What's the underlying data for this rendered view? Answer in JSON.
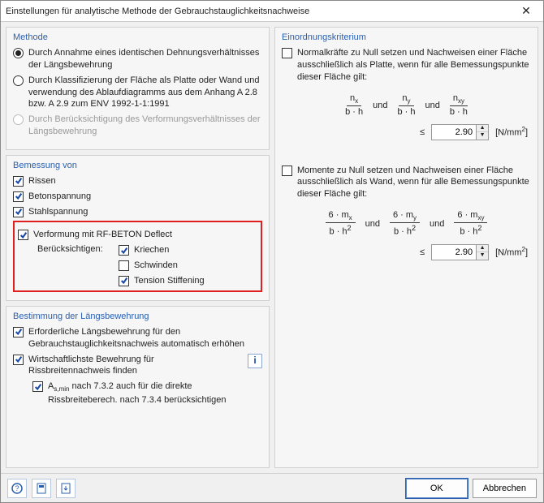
{
  "window": {
    "title": "Einstellungen für analytische Methode der Gebrauchstauglichkeitsnachweise"
  },
  "method": {
    "legend": "Methode",
    "opt1": "Durch Annahme eines identischen Dehnungsverhältnisses der Längsbewehrung",
    "opt2": "Durch Klassifizierung der Fläche als Platte oder Wand und verwendung des Ablaufdiagramms aus dem Anhang A 2.8 bzw. A 2.9 zum ENV 1992-1-1:1991",
    "opt3": "Durch Berücksichtigung des Verformungs­verhältnisses der Längsbewehrung"
  },
  "design": {
    "legend": "Bemessung von",
    "c1": "Rissen",
    "c2": "Betonspannung",
    "c3": "Stahlspannung",
    "c4": "Verformung mit RF-BETON Deflect",
    "sublabel": "Berücksichtigen:",
    "s1": "Kriechen",
    "s2": "Schwinden",
    "s3": "Tension Stiffening"
  },
  "longitudinal": {
    "legend": "Bestimmung der Längsbewehrung",
    "c1": "Erforderliche Längsbewehrung für den Gebrauchstauglichkeitsnachweis automatisch erhöhen",
    "c2": "Wirtschaftlichste Bewehrung für Rissbreitennachweis finden",
    "c3_pre": "A",
    "c3_sub": "s,min",
    "c3_post": " nach 7.3.2 auch für die direkte Rissbreiteberech. nach 7.3.4 berücksichtigen"
  },
  "classification": {
    "legend": "Einordnungskriterium",
    "c1": "Normalkräfte zu Null setzen und Nachweisen einer Fläche ausschließlich als Platte, wenn für alle Bemessungspunkte dieser Fläche gilt:",
    "c2": "Momente zu Null setzen und Nachweisen einer Fläche ausschließlich als Wand, wenn für alle Bemessungspunkte dieser Fläche gilt:",
    "and": "und",
    "leq": "≤",
    "val1": "2.90",
    "val2": "2.90",
    "unit_pre": "[N/mm",
    "unit_sup": "2",
    "unit_post": "]",
    "f1": {
      "n": "n",
      "idx_x": "x",
      "idx_y": "y",
      "idx_xy": "xy",
      "den": "b · h"
    },
    "f2": {
      "pre": "6 · m",
      "den": "b · h",
      "sup": "2"
    }
  },
  "footer": {
    "ok": "OK",
    "cancel": "Abbrechen"
  }
}
